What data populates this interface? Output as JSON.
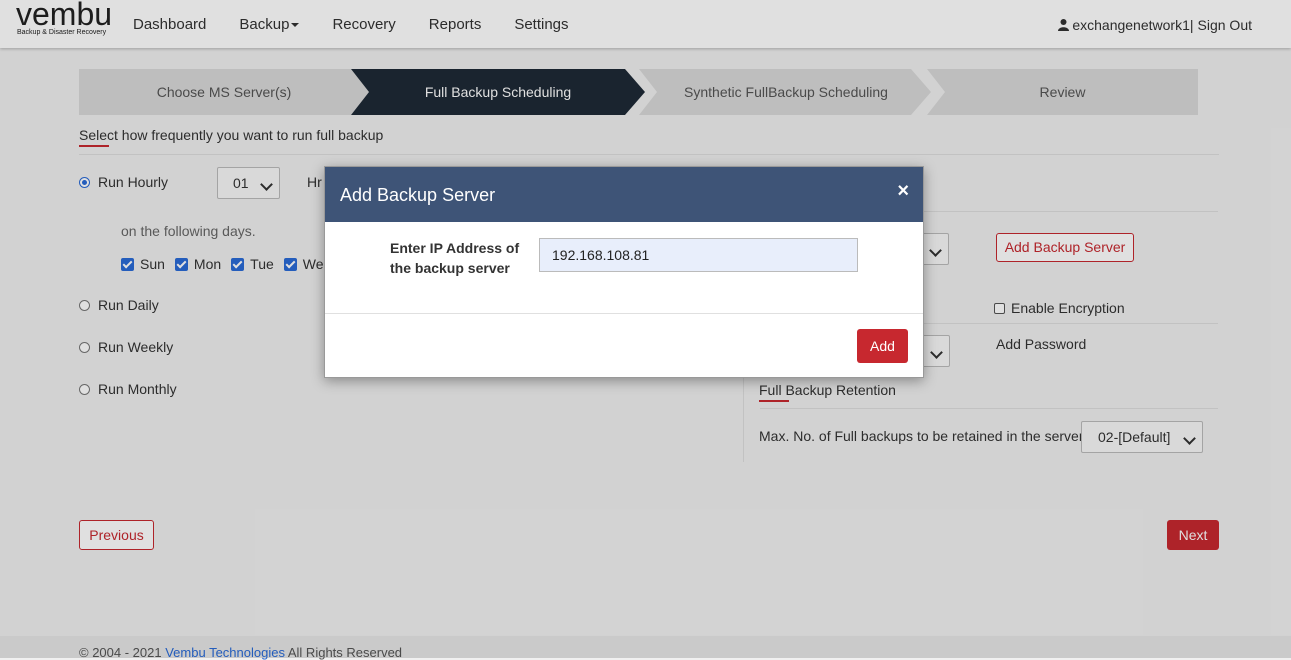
{
  "header": {
    "logo_word": "vembu",
    "logo_tagline": "Backup & Disaster Recovery",
    "nav": [
      "Dashboard",
      "Backup",
      "Recovery",
      "Reports",
      "Settings"
    ],
    "username": "exchangenetwork1",
    "separator": "|",
    "signout": "Sign Out"
  },
  "steps": [
    {
      "label": "Choose MS Server(s)",
      "active": false
    },
    {
      "label": "Full Backup Scheduling",
      "active": true
    },
    {
      "label": "Synthetic FullBackup Scheduling",
      "active": false
    },
    {
      "label": "Review",
      "active": false
    }
  ],
  "schedule": {
    "title": "Select how frequently you want to run full backup",
    "run_hourly": "Run Hourly",
    "hourly_value": "01",
    "hrs_label": "Hr",
    "following_days": "on the following days.",
    "days": [
      "Sun",
      "Mon",
      "Tue",
      "We"
    ],
    "run_daily": "Run Daily",
    "run_weekly": "Run Weekly",
    "run_monthly": "Run Monthly"
  },
  "right_panel": {
    "add_backup_server": "Add Backup Server",
    "enable_encryption": "Enable Encryption",
    "add_password": "Add Password",
    "retention_title": "Full Backup Retention",
    "retention_label": "Max. No. of Full backups to be retained in the server",
    "retention_value": "02-[Default]"
  },
  "nav_buttons": {
    "previous": "Previous",
    "next": "Next"
  },
  "footer": {
    "copyright": "© 2004 - 2021",
    "company": "Vembu Technologies",
    "rights": "All Rights Reserved"
  },
  "modal": {
    "title": "Add Backup Server",
    "close": "×",
    "ip_label": "Enter IP Address of the backup server",
    "ip_value": "192.168.108.81",
    "add_button": "Add"
  },
  "colors": {
    "accent_red": "#c7282f",
    "modal_header": "#3e5477",
    "active_step": "#1e2a36",
    "checkbox_blue": "#2a6ad6"
  }
}
